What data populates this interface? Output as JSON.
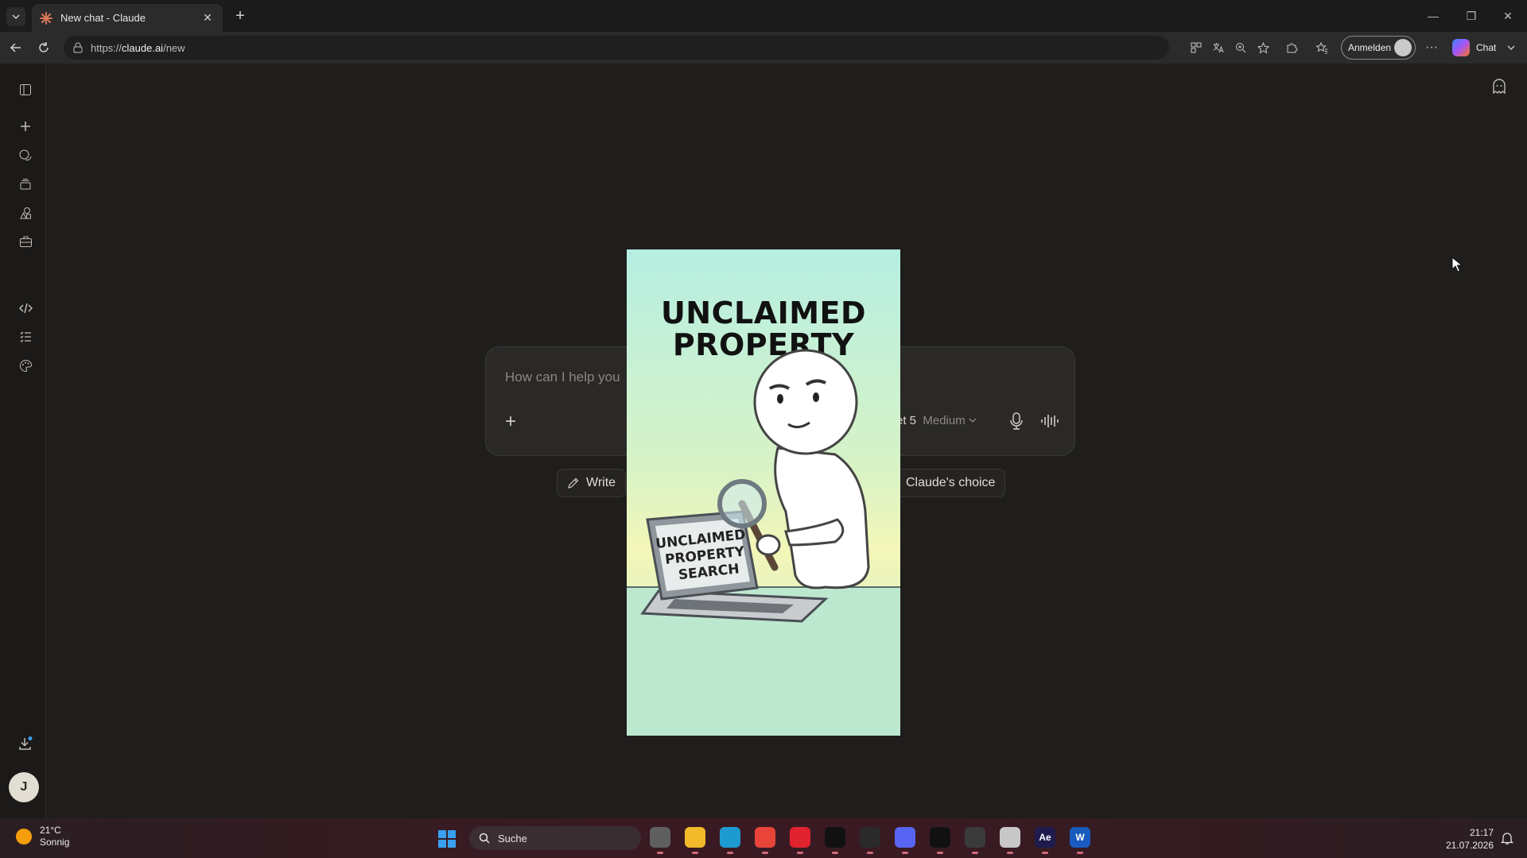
{
  "browser": {
    "tab_title": "New chat - Claude",
    "tab_close": "✕",
    "new_tab": "+",
    "url_scheme": "https://",
    "url_host": "claude.ai",
    "url_path": "/new",
    "signin_label": "Anmelden",
    "more_label": "···",
    "copilot_label": "Chat",
    "window_minimize": "—",
    "window_restore": "❐",
    "window_close": "✕"
  },
  "app": {
    "composer": {
      "placeholder": "How can I help you",
      "add_label": "+",
      "model_partial": "et 5",
      "effort_label": "Medium"
    },
    "chips": [
      {
        "label": "Write"
      },
      {
        "label": "Claude's choice"
      }
    ],
    "user_initial": "J"
  },
  "overlay_image": {
    "headline_line1": "UNCLAIMED",
    "headline_line2": "PROPERTY",
    "screen_line1": "UNCLAIMED",
    "screen_line2": "PROPERTY",
    "screen_line3": "SEARCH"
  },
  "taskbar": {
    "weather_temp": "21°C",
    "weather_desc": "Sonnig",
    "search_label": "Suche",
    "time": "21:17",
    "date": "21.07.2026",
    "apps": [
      {
        "name": "task-view",
        "color": "#5f5f5f",
        "label": ""
      },
      {
        "name": "file-explorer",
        "color": "#f2b92a",
        "label": ""
      },
      {
        "name": "edge",
        "color": "#1d9bd1",
        "label": ""
      },
      {
        "name": "chrome",
        "color": "#e8443a",
        "label": ""
      },
      {
        "name": "opera",
        "color": "#e0232e",
        "label": ""
      },
      {
        "name": "capcut",
        "color": "#111111",
        "label": ""
      },
      {
        "name": "chatgpt",
        "color": "#2a2a2a",
        "label": ""
      },
      {
        "name": "discord",
        "color": "#5865f2",
        "label": ""
      },
      {
        "name": "capcut-2",
        "color": "#111111",
        "label": ""
      },
      {
        "name": "media-player",
        "color": "#3a3a3a",
        "label": ""
      },
      {
        "name": "snipping-tool",
        "color": "#c7c7c7",
        "label": ""
      },
      {
        "name": "after-effects",
        "color": "#1f1b4d",
        "label": "Ae"
      },
      {
        "name": "word",
        "color": "#185abd",
        "label": "W"
      }
    ]
  },
  "colors": {
    "accent_blue": "#3aa0f0",
    "app_bg": "#1f1e1d"
  }
}
